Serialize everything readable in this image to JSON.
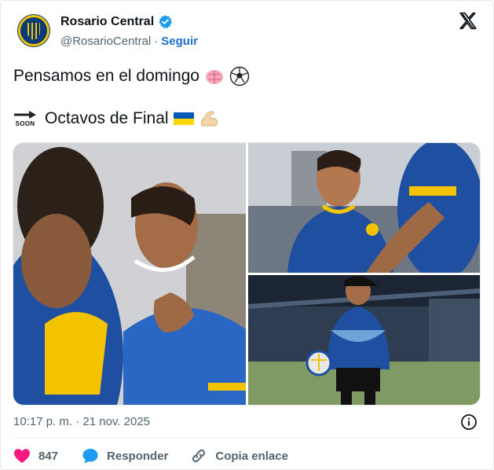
{
  "account": {
    "display_name": "Rosario Central",
    "handle": "@RosarioCentral",
    "separator": "·",
    "follow_label": "Seguir"
  },
  "tweet": {
    "line1_text": "Pensamos en el domingo",
    "line1_emojis": [
      "brain-emoji",
      "soccer-ball-emoji"
    ],
    "line2_badge": "SOON",
    "line2_text": "Octavos de Final",
    "line2_emojis": [
      "ukraine-flag-emoji",
      "flexed-biceps-emoji"
    ]
  },
  "media": {
    "photos": [
      "player-smiling-photo",
      "player-in-jersey-photo",
      "coach-with-ball-photo"
    ]
  },
  "meta": {
    "timestamp": "10:17 p. m. · 21 nov. 2025"
  },
  "actions": {
    "like_count": "847",
    "reply_label": "Responder",
    "copy_link_label": "Copia enlace"
  },
  "colors": {
    "accent": "#1d9bf0",
    "like": "#f91880",
    "club_blue": "#0b3a7a",
    "club_yellow": "#f5c400"
  }
}
